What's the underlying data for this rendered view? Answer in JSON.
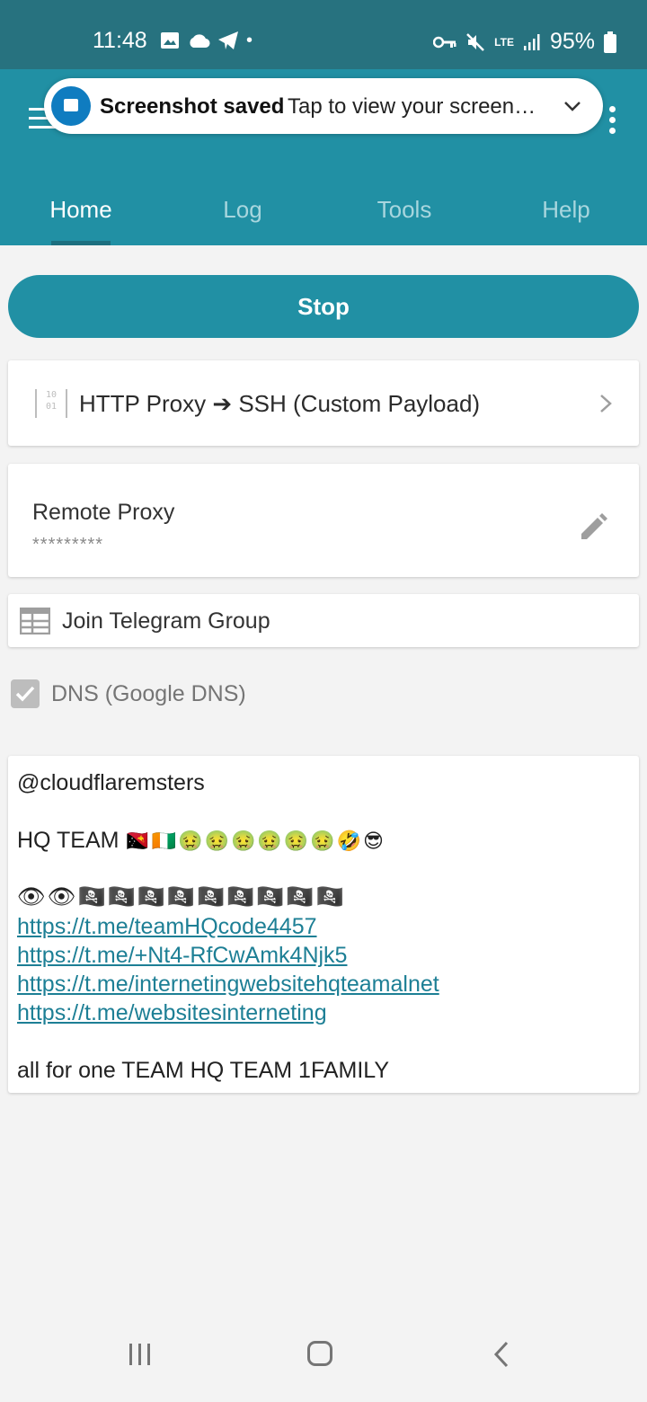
{
  "status_bar": {
    "time": "11:48",
    "network_label": "LTE",
    "battery": "95%",
    "notification_dot": "•"
  },
  "toast": {
    "title": "Screenshot saved",
    "message": "Tap to view your screen…",
    "icon": "image-icon",
    "expand_icon": "chevron-down-icon"
  },
  "tabs": [
    {
      "label": "Home",
      "active": true
    },
    {
      "label": "Log",
      "active": false
    },
    {
      "label": "Tools",
      "active": false
    },
    {
      "label": "Help",
      "active": false
    }
  ],
  "main": {
    "stop_label": "Stop",
    "mode_label": "HTTP Proxy ➔ SSH (Custom Payload)",
    "remote_proxy_title": "Remote Proxy",
    "remote_proxy_value": "*********",
    "telegram_label": "Join Telegram Group",
    "dns_label": "DNS (Google DNS)",
    "dns_checked": true
  },
  "message": {
    "line1": "@cloudflaremsters",
    "line2_text": "HQ TEAM",
    "line2_emoji": "🇵🇬🇨🇮🤢🤢🤢🤢🤢🤢🤣😎",
    "line3_emoji": "👁👁🏴‍☠️🏴‍☠️🏴‍☠️🏴‍☠️🏴‍☠️🏴‍☠️🏴‍☠️🏴‍☠️🏴‍☠️",
    "links": [
      "https://t.me/teamHQcode4457",
      "https://t.me/+Nt4-RfCwAmk4Njk5",
      "https://t.me/internetingwebsitehqteamalnet",
      "https://t.me/websitesinterneting"
    ],
    "footer": "all for one TEAM HQ TEAM 1FAMILY"
  },
  "colors": {
    "status_bar": "#27727f",
    "app_bar": "#2190a4",
    "link": "#1d7f95"
  }
}
